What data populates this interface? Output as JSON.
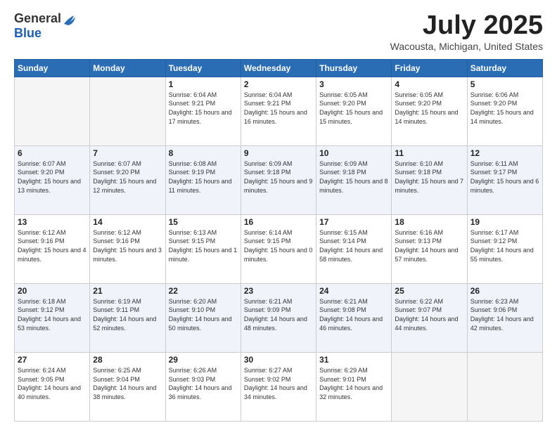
{
  "header": {
    "logo_general": "General",
    "logo_blue": "Blue",
    "month": "July 2025",
    "location": "Wacousta, Michigan, United States"
  },
  "weekdays": [
    "Sunday",
    "Monday",
    "Tuesday",
    "Wednesday",
    "Thursday",
    "Friday",
    "Saturday"
  ],
  "weeks": [
    [
      {
        "day": "",
        "sunrise": "",
        "sunset": "",
        "daylight": ""
      },
      {
        "day": "",
        "sunrise": "",
        "sunset": "",
        "daylight": ""
      },
      {
        "day": "1",
        "sunrise": "Sunrise: 6:04 AM",
        "sunset": "Sunset: 9:21 PM",
        "daylight": "Daylight: 15 hours and 17 minutes."
      },
      {
        "day": "2",
        "sunrise": "Sunrise: 6:04 AM",
        "sunset": "Sunset: 9:21 PM",
        "daylight": "Daylight: 15 hours and 16 minutes."
      },
      {
        "day": "3",
        "sunrise": "Sunrise: 6:05 AM",
        "sunset": "Sunset: 9:20 PM",
        "daylight": "Daylight: 15 hours and 15 minutes."
      },
      {
        "day": "4",
        "sunrise": "Sunrise: 6:05 AM",
        "sunset": "Sunset: 9:20 PM",
        "daylight": "Daylight: 15 hours and 14 minutes."
      },
      {
        "day": "5",
        "sunrise": "Sunrise: 6:06 AM",
        "sunset": "Sunset: 9:20 PM",
        "daylight": "Daylight: 15 hours and 14 minutes."
      }
    ],
    [
      {
        "day": "6",
        "sunrise": "Sunrise: 6:07 AM",
        "sunset": "Sunset: 9:20 PM",
        "daylight": "Daylight: 15 hours and 13 minutes."
      },
      {
        "day": "7",
        "sunrise": "Sunrise: 6:07 AM",
        "sunset": "Sunset: 9:20 PM",
        "daylight": "Daylight: 15 hours and 12 minutes."
      },
      {
        "day": "8",
        "sunrise": "Sunrise: 6:08 AM",
        "sunset": "Sunset: 9:19 PM",
        "daylight": "Daylight: 15 hours and 11 minutes."
      },
      {
        "day": "9",
        "sunrise": "Sunrise: 6:09 AM",
        "sunset": "Sunset: 9:18 PM",
        "daylight": "Daylight: 15 hours and 9 minutes."
      },
      {
        "day": "10",
        "sunrise": "Sunrise: 6:09 AM",
        "sunset": "Sunset: 9:18 PM",
        "daylight": "Daylight: 15 hours and 8 minutes."
      },
      {
        "day": "11",
        "sunrise": "Sunrise: 6:10 AM",
        "sunset": "Sunset: 9:18 PM",
        "daylight": "Daylight: 15 hours and 7 minutes."
      },
      {
        "day": "12",
        "sunrise": "Sunrise: 6:11 AM",
        "sunset": "Sunset: 9:17 PM",
        "daylight": "Daylight: 15 hours and 6 minutes."
      }
    ],
    [
      {
        "day": "13",
        "sunrise": "Sunrise: 6:12 AM",
        "sunset": "Sunset: 9:16 PM",
        "daylight": "Daylight: 15 hours and 4 minutes."
      },
      {
        "day": "14",
        "sunrise": "Sunrise: 6:12 AM",
        "sunset": "Sunset: 9:16 PM",
        "daylight": "Daylight: 15 hours and 3 minutes."
      },
      {
        "day": "15",
        "sunrise": "Sunrise: 6:13 AM",
        "sunset": "Sunset: 9:15 PM",
        "daylight": "Daylight: 15 hours and 1 minute."
      },
      {
        "day": "16",
        "sunrise": "Sunrise: 6:14 AM",
        "sunset": "Sunset: 9:15 PM",
        "daylight": "Daylight: 15 hours and 0 minutes."
      },
      {
        "day": "17",
        "sunrise": "Sunrise: 6:15 AM",
        "sunset": "Sunset: 9:14 PM",
        "daylight": "Daylight: 14 hours and 58 minutes."
      },
      {
        "day": "18",
        "sunrise": "Sunrise: 6:16 AM",
        "sunset": "Sunset: 9:13 PM",
        "daylight": "Daylight: 14 hours and 57 minutes."
      },
      {
        "day": "19",
        "sunrise": "Sunrise: 6:17 AM",
        "sunset": "Sunset: 9:12 PM",
        "daylight": "Daylight: 14 hours and 55 minutes."
      }
    ],
    [
      {
        "day": "20",
        "sunrise": "Sunrise: 6:18 AM",
        "sunset": "Sunset: 9:12 PM",
        "daylight": "Daylight: 14 hours and 53 minutes."
      },
      {
        "day": "21",
        "sunrise": "Sunrise: 6:19 AM",
        "sunset": "Sunset: 9:11 PM",
        "daylight": "Daylight: 14 hours and 52 minutes."
      },
      {
        "day": "22",
        "sunrise": "Sunrise: 6:20 AM",
        "sunset": "Sunset: 9:10 PM",
        "daylight": "Daylight: 14 hours and 50 minutes."
      },
      {
        "day": "23",
        "sunrise": "Sunrise: 6:21 AM",
        "sunset": "Sunset: 9:09 PM",
        "daylight": "Daylight: 14 hours and 48 minutes."
      },
      {
        "day": "24",
        "sunrise": "Sunrise: 6:21 AM",
        "sunset": "Sunset: 9:08 PM",
        "daylight": "Daylight: 14 hours and 46 minutes."
      },
      {
        "day": "25",
        "sunrise": "Sunrise: 6:22 AM",
        "sunset": "Sunset: 9:07 PM",
        "daylight": "Daylight: 14 hours and 44 minutes."
      },
      {
        "day": "26",
        "sunrise": "Sunrise: 6:23 AM",
        "sunset": "Sunset: 9:06 PM",
        "daylight": "Daylight: 14 hours and 42 minutes."
      }
    ],
    [
      {
        "day": "27",
        "sunrise": "Sunrise: 6:24 AM",
        "sunset": "Sunset: 9:05 PM",
        "daylight": "Daylight: 14 hours and 40 minutes."
      },
      {
        "day": "28",
        "sunrise": "Sunrise: 6:25 AM",
        "sunset": "Sunset: 9:04 PM",
        "daylight": "Daylight: 14 hours and 38 minutes."
      },
      {
        "day": "29",
        "sunrise": "Sunrise: 6:26 AM",
        "sunset": "Sunset: 9:03 PM",
        "daylight": "Daylight: 14 hours and 36 minutes."
      },
      {
        "day": "30",
        "sunrise": "Sunrise: 6:27 AM",
        "sunset": "Sunset: 9:02 PM",
        "daylight": "Daylight: 14 hours and 34 minutes."
      },
      {
        "day": "31",
        "sunrise": "Sunrise: 6:29 AM",
        "sunset": "Sunset: 9:01 PM",
        "daylight": "Daylight: 14 hours and 32 minutes."
      },
      {
        "day": "",
        "sunrise": "",
        "sunset": "",
        "daylight": ""
      },
      {
        "day": "",
        "sunrise": "",
        "sunset": "",
        "daylight": ""
      }
    ]
  ]
}
